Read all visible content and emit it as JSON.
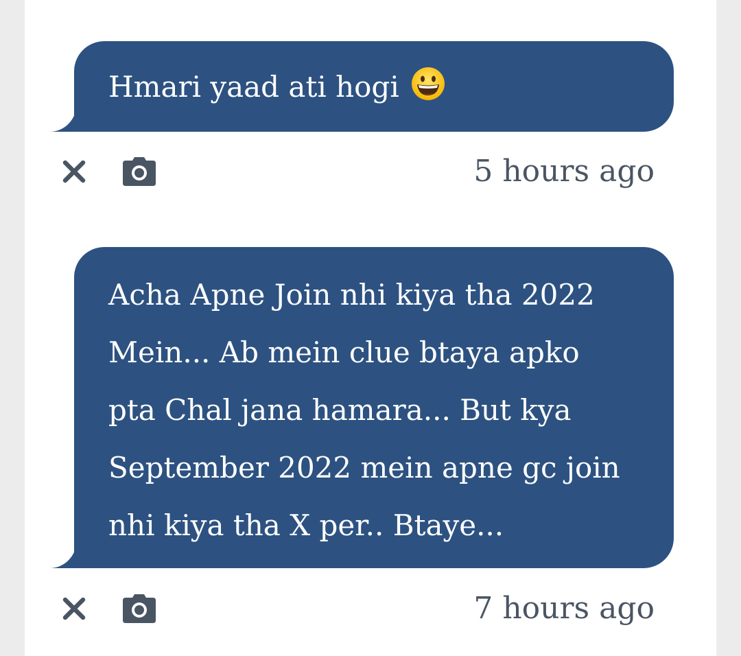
{
  "messages": [
    {
      "text": "Hmari yaad ati hogi",
      "emoji": "grinning-face",
      "timestamp": "5 hours ago"
    },
    {
      "lines": [
        "Acha Apne Join nhi kiya tha 2022",
        "Mein... Ab mein clue btaya apko",
        "pta Chal jana hamara... But kya",
        "September 2022 mein apne gc join",
        "nhi kiya tha X per.. Btaye..."
      ],
      "timestamp": "7 hours ago"
    }
  ],
  "icons": {
    "close": "close-icon",
    "camera": "camera-icon"
  },
  "colors": {
    "bubble": "#2d5281",
    "bubble_text": "#ffffff",
    "timestamp_text": "#4a5563",
    "icon": "#4a5563",
    "background": "#ffffff",
    "side_background": "#ececec"
  }
}
